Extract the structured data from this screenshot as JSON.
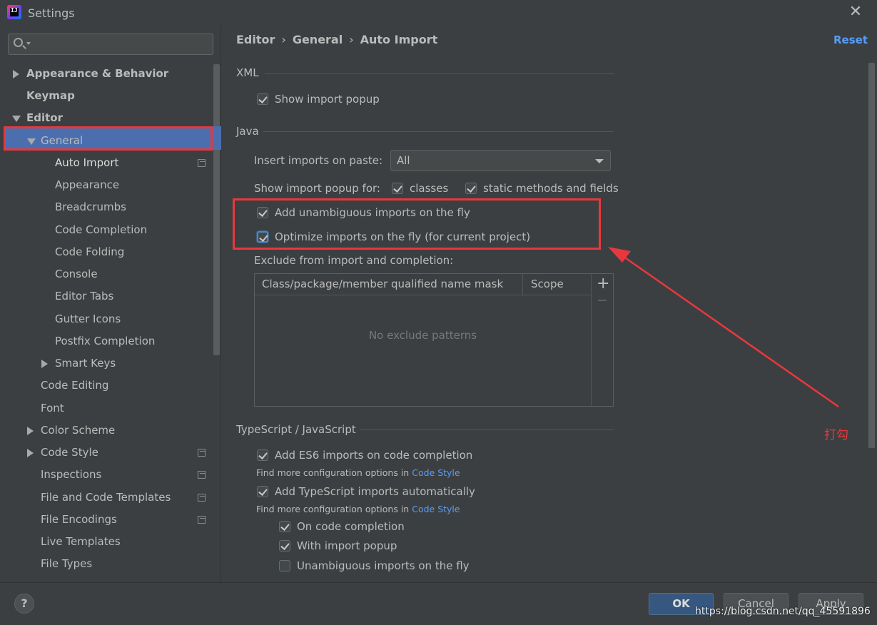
{
  "window": {
    "title": "Settings",
    "close": "✕"
  },
  "search": {
    "placeholder": ""
  },
  "tree": {
    "appearance_behavior": "Appearance & Behavior",
    "keymap": "Keymap",
    "editor": "Editor",
    "general": "General",
    "auto_import": "Auto Import",
    "appearance": "Appearance",
    "breadcrumbs": "Breadcrumbs",
    "code_completion": "Code Completion",
    "code_folding": "Code Folding",
    "console": "Console",
    "editor_tabs": "Editor Tabs",
    "gutter_icons": "Gutter Icons",
    "postfix_completion": "Postfix Completion",
    "smart_keys": "Smart Keys",
    "code_editing": "Code Editing",
    "font": "Font",
    "color_scheme": "Color Scheme",
    "code_style": "Code Style",
    "inspections": "Inspections",
    "file_code_templates": "File and Code Templates",
    "file_encodings": "File Encodings",
    "live_templates": "Live Templates",
    "file_types": "File Types"
  },
  "breadcrumb": {
    "editor": "Editor",
    "general": "General",
    "auto_import": "Auto Import",
    "sep": "›"
  },
  "reset": "Reset",
  "xml": {
    "title": "XML",
    "show_import_popup": "Show import popup",
    "show_import_popup_checked": true
  },
  "java": {
    "title": "Java",
    "insert_imports_label": "Insert imports on paste:",
    "insert_imports_value": "All",
    "show_popup_for_label": "Show import popup for:",
    "classes": "classes",
    "static_methods": "static methods and fields",
    "add_unambiguous": "Add unambiguous imports on the fly",
    "optimize_imports": "Optimize imports on the fly (for current project)",
    "exclude_label": "Exclude from import and completion:",
    "col_mask": "Class/package/member qualified name mask",
    "col_scope": "Scope",
    "add_btn": "+",
    "empty": "No exclude patterns"
  },
  "ts": {
    "title": "TypeScript / JavaScript",
    "add_es6": "Add ES6 imports on code completion",
    "hint_prefix": "Find more configuration options in",
    "hint_link": "Code Style",
    "add_ts_auto": "Add TypeScript imports automatically",
    "on_completion": "On code completion",
    "with_popup": "With import popup",
    "unambiguous_fly": "Unambiguous imports on the fly"
  },
  "annotation": {
    "text": "打勾",
    "color": "#e8383d"
  },
  "footer": {
    "help": "?",
    "ok": "OK",
    "cancel": "Cancel",
    "apply": "Apply",
    "watermark": "https://blog.csdn.net/qq_45591896"
  },
  "colors": {
    "accent": "#4b6eaf",
    "link": "#589df6",
    "background": "#3c3f41",
    "highlight": "#e8383d"
  },
  "icons": [
    "intellij-logo-icon",
    "close-icon",
    "search-icon",
    "expand-triangle-icon",
    "project-scope-icon",
    "help-icon"
  ]
}
